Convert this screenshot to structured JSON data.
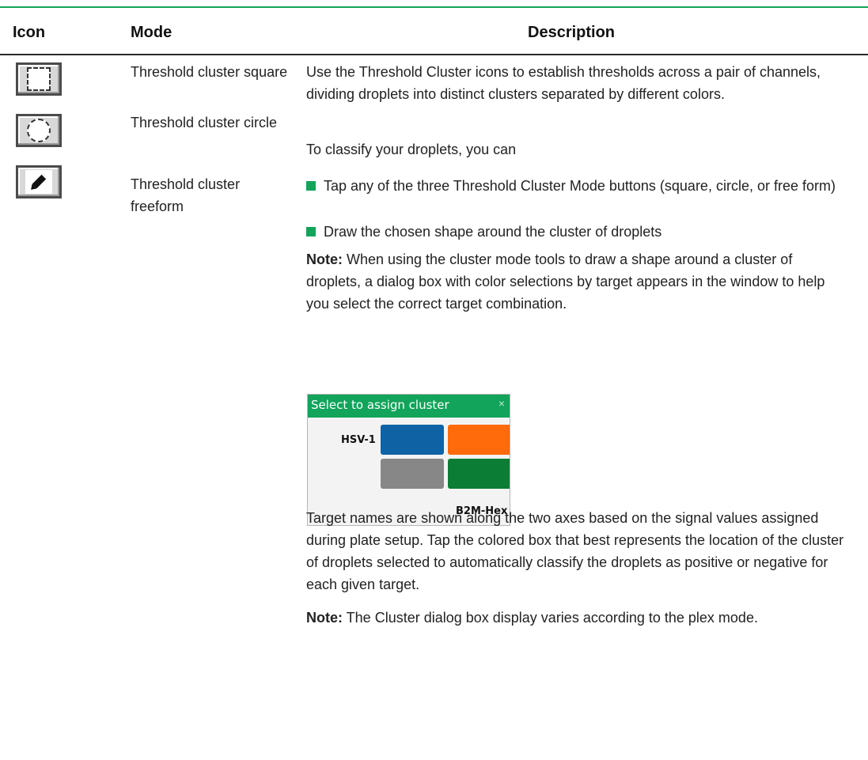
{
  "table": {
    "headers": {
      "icon": "Icon",
      "mode": "Mode",
      "description": "Description"
    },
    "modes": [
      {
        "icon": "dashed-square-icon",
        "label": "Threshold cluster square"
      },
      {
        "icon": "dashed-circle-icon",
        "label": "Threshold cluster circle"
      },
      {
        "icon": "pencil-icon",
        "label": "Threshold cluster freeform"
      }
    ]
  },
  "description": {
    "intro": "Use the Threshold Cluster icons to establish thresholds across a pair of channels, dividing droplets into distinct clusters separated by different colors.",
    "classify_lead": "To classify your droplets, you can",
    "bullets": [
      "Tap any of the three Threshold Cluster Mode buttons (square, circle, or free form)",
      "Draw the chosen shape around the cluster of droplets"
    ],
    "note1_label": "Note:",
    "note1_text": " When using the cluster mode tools to draw a shape around a cluster of droplets, a dialog box with color selections by target appears in the window to help you select the correct target combination.",
    "targets_paragraph": "Target names are shown along the two axes based on the signal values assigned during plate setup. Tap the colored box that best represents the location of the cluster of droplets selected to automatically classify the droplets as positive or negative for each given target.",
    "note2_label": "Note:",
    "note2_text": " The Cluster dialog box display varies according to the plex mode."
  },
  "dialog": {
    "title": "Select to assign cluster",
    "close": "×",
    "y_target": "HSV-1",
    "x_target": "B2M-Hex",
    "cells": [
      {
        "name": "cluster-blue",
        "color": "#0f63a4"
      },
      {
        "name": "cluster-orange",
        "color": "#ff6a0b"
      },
      {
        "name": "cluster-gray",
        "color": "#878787"
      },
      {
        "name": "cluster-green",
        "color": "#0b7d35"
      }
    ]
  },
  "colors": {
    "accent": "#11a45a"
  }
}
